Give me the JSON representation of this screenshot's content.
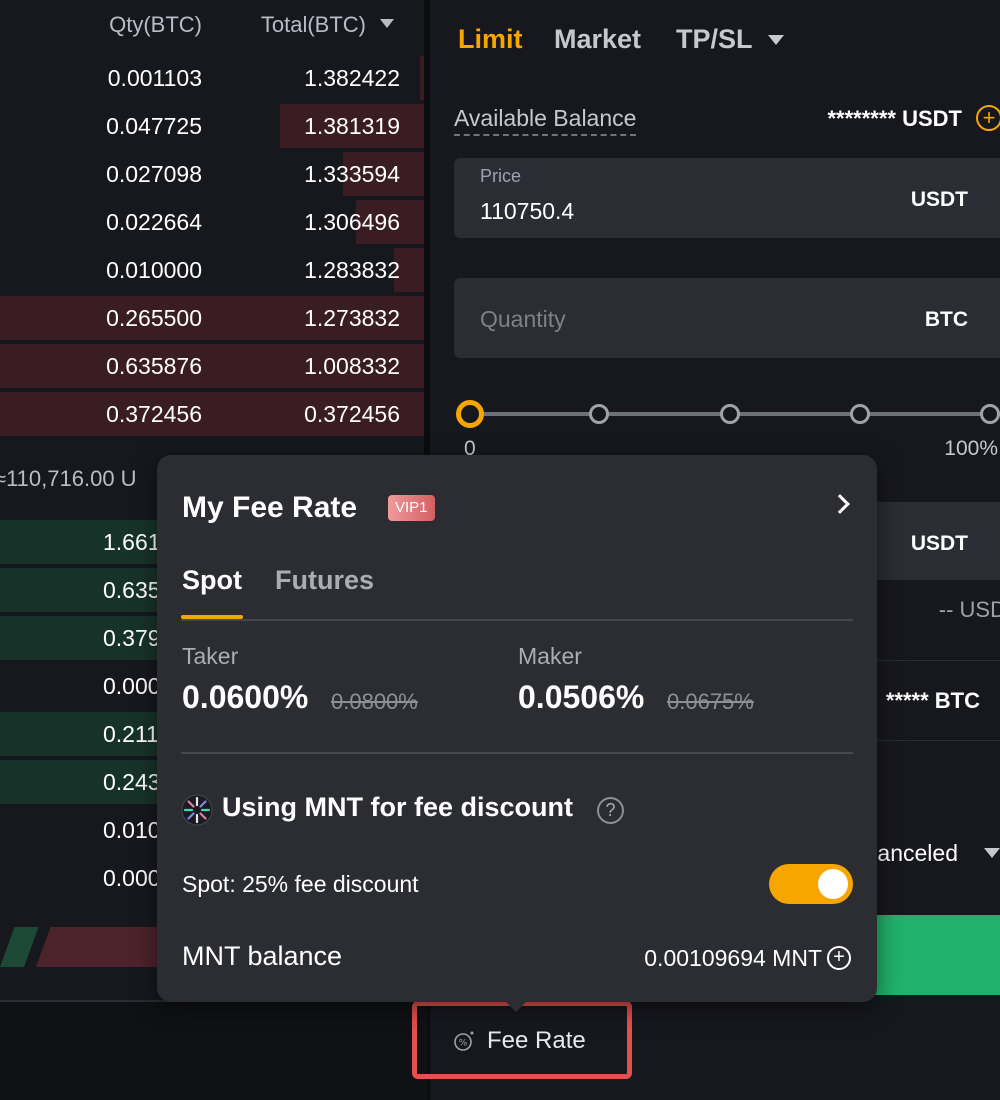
{
  "orderbook": {
    "header": {
      "qty": "Qty(BTC)",
      "total": "Total(BTC)"
    },
    "asks": [
      {
        "qty": "0.001103",
        "total": "1.382422",
        "depth": 0.01
      },
      {
        "qty": "0.047725",
        "total": "1.381319",
        "depth": 0.34
      },
      {
        "qty": "0.027098",
        "total": "1.333594",
        "depth": 0.19
      },
      {
        "qty": "0.022664",
        "total": "1.306496",
        "depth": 0.16
      },
      {
        "qty": "0.010000",
        "total": "1.283832",
        "depth": 0.07
      },
      {
        "qty": "0.265500",
        "total": "1.273832",
        "depth": 1.0
      },
      {
        "qty": "0.635876",
        "total": "1.008332",
        "depth": 1.0
      },
      {
        "qty": "0.372456",
        "total": "0.372456",
        "depth": 1.0
      }
    ],
    "mid_price": "≈110,716.00 U",
    "bids": [
      {
        "qty": "1.661",
        "depth": 1.0
      },
      {
        "qty": "0.635",
        "depth": 1.0
      },
      {
        "qty": "0.379",
        "depth": 1.0
      },
      {
        "qty": "0.000",
        "depth": 0.0
      },
      {
        "qty": "0.211",
        "depth": 1.0
      },
      {
        "qty": "0.243",
        "depth": 1.0
      },
      {
        "qty": "0.010",
        "depth": 0.0
      },
      {
        "qty": "0.000",
        "depth": 0.0
      }
    ]
  },
  "order_panel": {
    "tabs": {
      "limit": "Limit",
      "market": "Market",
      "tpsl": "TP/SL"
    },
    "available_balance": {
      "label": "Available Balance",
      "value": "******** USDT"
    },
    "price": {
      "label": "Price",
      "value": "110750.4",
      "unit": "USDT"
    },
    "quantity": {
      "placeholder": "Quantity",
      "unit": "BTC"
    },
    "slider": {
      "min_label": "0",
      "max_label": "100%",
      "value": 0
    },
    "order_value_unit": "USDT",
    "max_buy": "-- USD",
    "max_sell": "***** BTC",
    "time_in_force": "anceled"
  },
  "fee_popover": {
    "title": "My Fee Rate",
    "vip_badge": "VIP1",
    "tabs": {
      "spot": "Spot",
      "futures": "Futures"
    },
    "taker": {
      "label": "Taker",
      "rate": "0.0600%",
      "original": "0.0800%"
    },
    "maker": {
      "label": "Maker",
      "rate": "0.0506%",
      "original": "0.0675%"
    },
    "mnt_title": "Using MNT for fee discount",
    "spot_discount": "Spot: 25% fee discount",
    "discount_enabled": true,
    "mnt_balance_label": "MNT balance",
    "mnt_balance_value": "0.00109694 MNT"
  },
  "fee_trigger": {
    "label": "Fee Rate"
  },
  "colors": {
    "accent": "#f7a600",
    "ask": "#3a1d22",
    "bid": "#173329",
    "buy": "#20b26c",
    "highlight": "#e3514d"
  }
}
